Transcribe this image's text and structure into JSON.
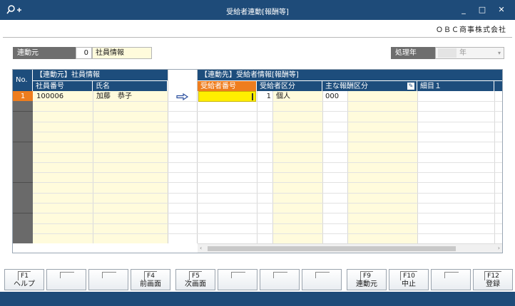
{
  "window": {
    "title": "受給者連動[報酬等]",
    "minimize": "_",
    "maximize": "□",
    "close": "✕"
  },
  "company": "ＯＢＣ商事株式会社",
  "source": {
    "label": "連動元",
    "code": "0",
    "name": "社員情報"
  },
  "year": {
    "label": "処理年",
    "value": "",
    "suffix": "年"
  },
  "grid": {
    "no_header": "No.",
    "left_group": "【連動元】社員情報",
    "left_columns": [
      "社員番号",
      "氏名"
    ],
    "right_group": "【連動先】受給者情報[報酬等]",
    "right_columns": [
      "受給者番号",
      "受給者区分",
      "主な報酬区分",
      "細目１"
    ],
    "rows": [
      {
        "no": "1",
        "employee_number": "100006",
        "employee_name": "加藤　恭子",
        "recipient_number": "",
        "recipient_type_code": "1",
        "recipient_type_name": "個人",
        "main_reward_code": "000"
      }
    ],
    "row_count": 15
  },
  "fkeys": [
    {
      "key": "F1",
      "label": "ヘルプ"
    },
    {
      "key": "",
      "label": ""
    },
    {
      "key": "",
      "label": ""
    },
    {
      "key": "F4",
      "label": "前画面"
    },
    {
      "key": "F5",
      "label": "次画面"
    },
    {
      "key": "",
      "label": ""
    },
    {
      "key": "",
      "label": ""
    },
    {
      "key": "",
      "label": ""
    },
    {
      "key": "F9",
      "label": "連動元"
    },
    {
      "key": "F10",
      "label": "中止"
    },
    {
      "key": "",
      "label": ""
    },
    {
      "key": "F12",
      "label": "登録"
    }
  ],
  "colors": {
    "header_blue": "#1d4d7c",
    "active_orange": "#ee7d1e",
    "cell_yellow": "#fffbdc",
    "focus_yellow": "#ffee00"
  }
}
